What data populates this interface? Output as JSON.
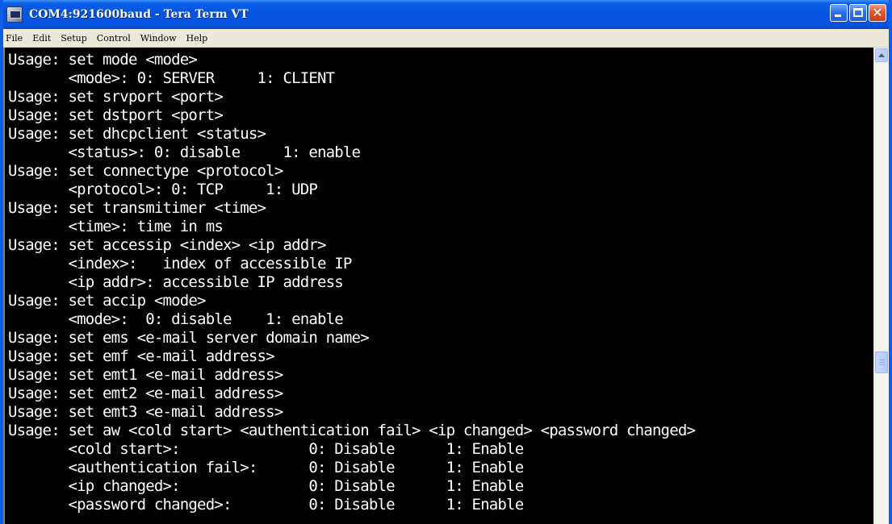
{
  "window": {
    "title": "COM4:921600baud - Tera Term VT"
  },
  "menu": [
    "File",
    "Edit",
    "Setup",
    "Control",
    "Window",
    "Help"
  ],
  "terminal": {
    "lines": [
      "Usage: set mode <mode>",
      "       <mode>: 0: SERVER     1: CLIENT",
      "Usage: set srvport <port>",
      "Usage: set dstport <port>",
      "Usage: set dhcpclient <status>",
      "       <status>: 0: disable     1: enable",
      "Usage: set connectype <protocol>",
      "       <protocol>: 0: TCP     1: UDP",
      "Usage: set transmitimer <time>",
      "       <time>: time in ms",
      "Usage: set accessip <index> <ip addr>",
      "       <index>:   index of accessible IP",
      "       <ip addr>: accessible IP address",
      "Usage: set accip <mode>",
      "       <mode>:  0: disable    1: enable",
      "Usage: set ems <e-mail server domain name>",
      "Usage: set emf <e-mail address>",
      "Usage: set emt1 <e-mail address>",
      "Usage: set emt2 <e-mail address>",
      "Usage: set emt3 <e-mail address>",
      "Usage: set aw <cold start> <authentication fail> <ip changed> <password changed>",
      "       <cold start>:               0: Disable      1: Enable",
      "       <authentication fail>:      0: Disable      1: Enable",
      "       <ip changed>:               0: Disable      1: Enable",
      "       <password changed>:         0: Disable      1: Enable"
    ]
  }
}
